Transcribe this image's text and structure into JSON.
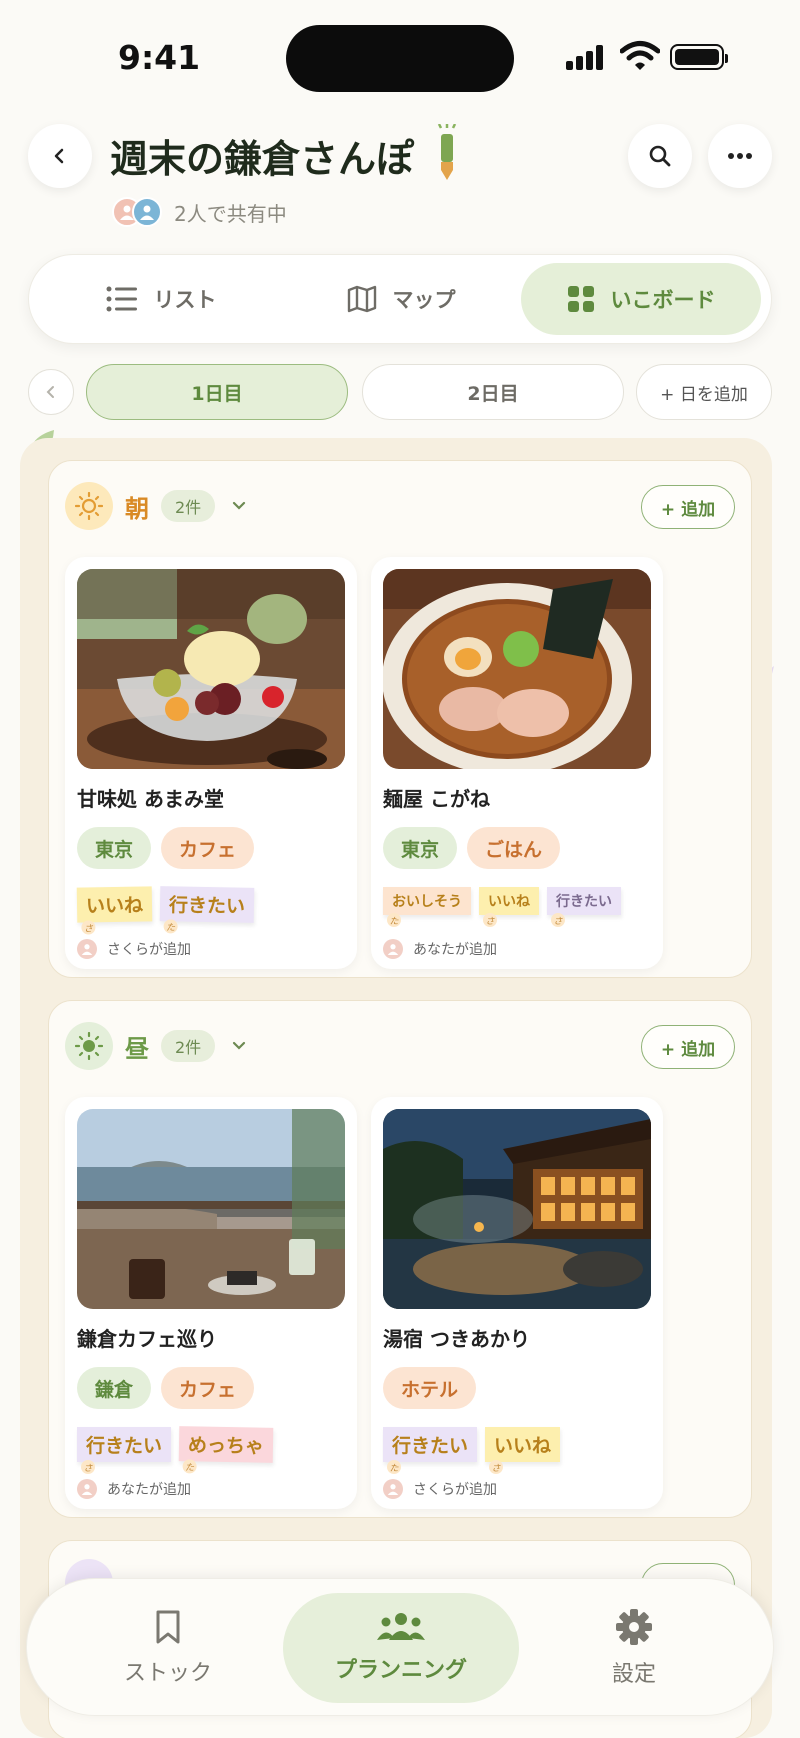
{
  "status": {
    "time": "9:41"
  },
  "header": {
    "title": "週末の鎌倉さんぽ",
    "shared_text": "2人で共有中"
  },
  "view_tabs": [
    {
      "label": "リスト",
      "icon": "list-icon"
    },
    {
      "label": "マップ",
      "icon": "map-icon"
    },
    {
      "label": "いこボード",
      "icon": "grid-icon",
      "active": true
    }
  ],
  "days": [
    {
      "label": "1日目",
      "active": true
    },
    {
      "label": "2日目"
    },
    {
      "label": "+ 日を追加"
    }
  ],
  "sections": [
    {
      "name": "朝",
      "count": "2件",
      "add_label": "+ 追加",
      "icon": "sunrise-icon",
      "cards": [
        {
          "name": "甘味処 あまみ堂",
          "tags": [
            "東京",
            "カフェ"
          ],
          "stickies": [
            "いいね",
            "行きたい"
          ],
          "sticky_users": [
            "さ",
            "た"
          ],
          "added_by": "さくらが追加"
        },
        {
          "name": "麺屋 こがね",
          "tags": [
            "東京",
            "ごはん"
          ],
          "stickies": [
            "おいしそう",
            "いいね",
            "行きたい"
          ],
          "sticky_users": [
            "た",
            "さ",
            "さ"
          ],
          "added_by": "あなたが追加"
        }
      ]
    },
    {
      "name": "昼",
      "count": "2件",
      "add_label": "+ 追加",
      "icon": "sun-icon",
      "cards": [
        {
          "name": "鎌倉カフェ巡り",
          "tags": [
            "鎌倉",
            "カフェ"
          ],
          "stickies": [
            "行きたい",
            "めっちゃ"
          ],
          "sticky_users": [
            "さ",
            "た"
          ],
          "added_by": "あなたが追加"
        },
        {
          "name": "湯宿 つきあかり",
          "tags": [
            "ホテル"
          ],
          "stickies": [
            "行きたい",
            "いいね"
          ],
          "sticky_users": [
            "た",
            "さ"
          ],
          "added_by": "さくらが追加"
        }
      ]
    }
  ],
  "nav": [
    {
      "label": "ストック",
      "icon": "bookmark-icon"
    },
    {
      "label": "プランニング",
      "icon": "people-icon",
      "active": true
    },
    {
      "label": "設定",
      "icon": "gear-icon"
    }
  ],
  "colors": {
    "accent": "#5e8a3e",
    "accent_bg": "#e5efd8",
    "board_bg": "#f6efe0"
  }
}
